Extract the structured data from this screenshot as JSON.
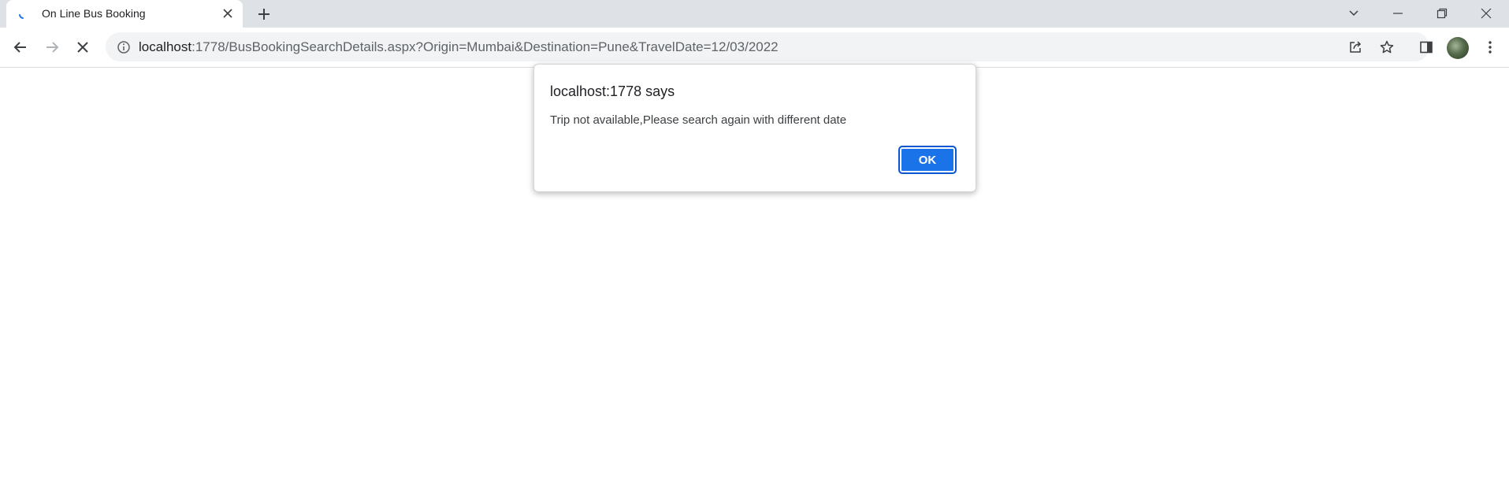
{
  "browser": {
    "tab": {
      "title": "On Line Bus Booking"
    },
    "address_bar": {
      "host": "localhost",
      "path": ":1778/BusBookingSearchDetails.aspx?Origin=Mumbai&Destination=Pune&TravelDate=12/03/2022"
    },
    "accent_color": "#1a73e8"
  },
  "alert": {
    "title": "localhost:1778 says",
    "message": "Trip not available,Please search again with different date",
    "ok_label": "OK"
  }
}
